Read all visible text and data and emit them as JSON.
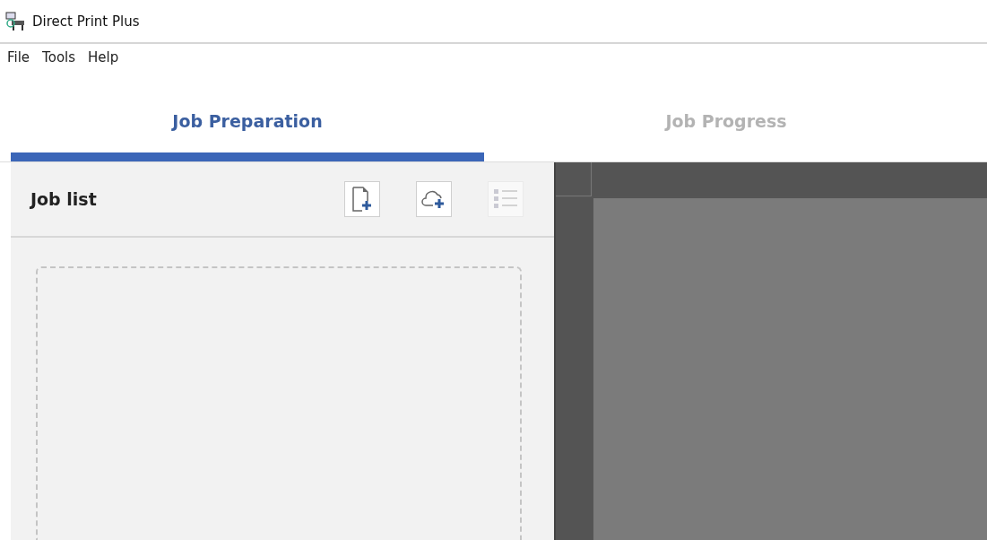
{
  "window": {
    "title": "Direct Print Plus"
  },
  "menu": [
    "File",
    "Tools",
    "Help"
  ],
  "tabs": [
    {
      "label": "Job Preparation",
      "selected": true
    },
    {
      "label": "Job Progress",
      "selected": false
    }
  ],
  "job_list": {
    "title": "Job list",
    "buttons": [
      {
        "kind": "add-file",
        "disabled": false
      },
      {
        "kind": "add-cloud",
        "disabled": false
      },
      {
        "kind": "list",
        "disabled": true
      }
    ]
  }
}
